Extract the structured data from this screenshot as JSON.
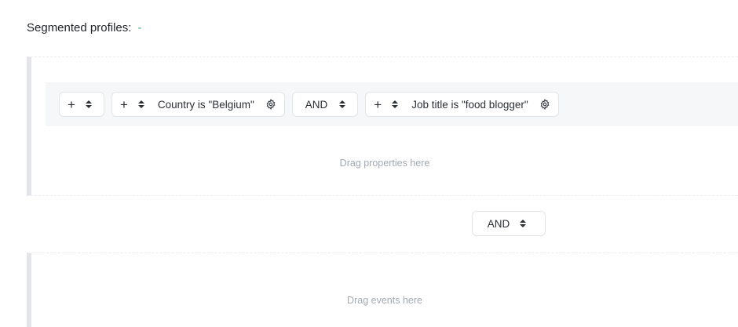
{
  "header": {
    "title": "Segmented profiles:",
    "value": "-"
  },
  "properties": {
    "rule_row": {
      "conditions": [
        {
          "text": "Country is \"Belgium\""
        },
        {
          "text": "Job title is \"food blogger\""
        }
      ],
      "operator": "AND"
    },
    "drop_hint": "Drag properties here"
  },
  "group_operator": "AND",
  "events": {
    "drop_hint": "Drag events here"
  },
  "icons": {
    "add": "plus-icon",
    "reorder": "up-down-icon",
    "settings": "gear-icon"
  },
  "colors": {
    "accent": "#47b08a",
    "border": "#e4e5ea",
    "hint": "#a3a8b1"
  }
}
